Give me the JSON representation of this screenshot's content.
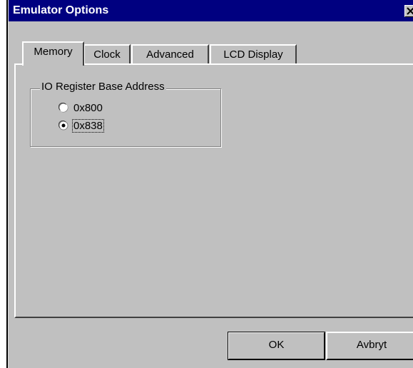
{
  "window": {
    "title": "Emulator Options",
    "close_glyph": "✕"
  },
  "tabs": [
    {
      "label": "Memory",
      "active": true
    },
    {
      "label": "Clock",
      "active": false
    },
    {
      "label": "Advanced",
      "active": false
    },
    {
      "label": "LCD Display",
      "active": false
    }
  ],
  "io_group": {
    "legend": "IO Register Base Address",
    "options": [
      {
        "label": "0x800",
        "selected": false
      },
      {
        "label": "0x838",
        "selected": true
      }
    ]
  },
  "buttons": {
    "ok_label": "OK",
    "cancel_label": "Avbryt"
  },
  "colors": {
    "titlebar": "#000080",
    "face": "#c0c0c0"
  }
}
